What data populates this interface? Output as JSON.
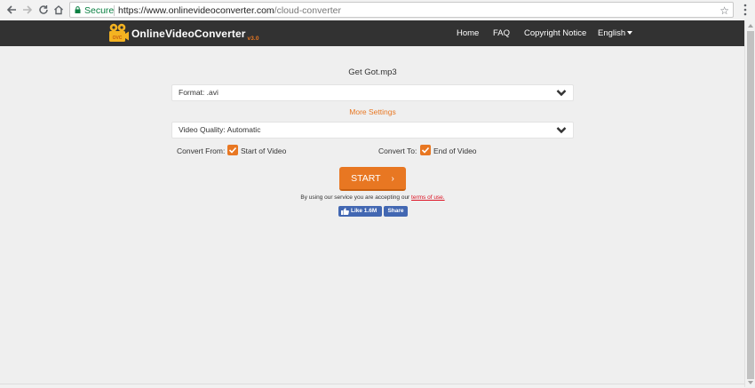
{
  "browser": {
    "secure_label": "Secure",
    "url_prefix": "https://www.onlinevideoconverter.com",
    "url_path": "/cloud-converter"
  },
  "site": {
    "logo_first": "Online",
    "logo_second": "Video",
    "logo_third": "Converter",
    "logo_version": "v3.0",
    "nav": [
      "Home",
      "FAQ",
      "Copyright Notice",
      "English"
    ]
  },
  "converter": {
    "file_name": "Get Got.mp3",
    "format_label": "Format: .avi",
    "more_settings": "More Settings",
    "quality_label": "Video Quality: Automatic",
    "convert_from_label": "Convert From:",
    "convert_from_value": "Start of Video",
    "convert_to_label": "Convert To:",
    "convert_to_value": "End of Video",
    "start_label": "START",
    "terms_text": "By using our service you are accepting our",
    "terms_link": "terms of use."
  },
  "social": {
    "like_label": "Like 1.6M",
    "share_label": "Share"
  },
  "colors": {
    "accent": "#e87722",
    "header_bg": "#323232",
    "facebook": "#4267b2"
  }
}
